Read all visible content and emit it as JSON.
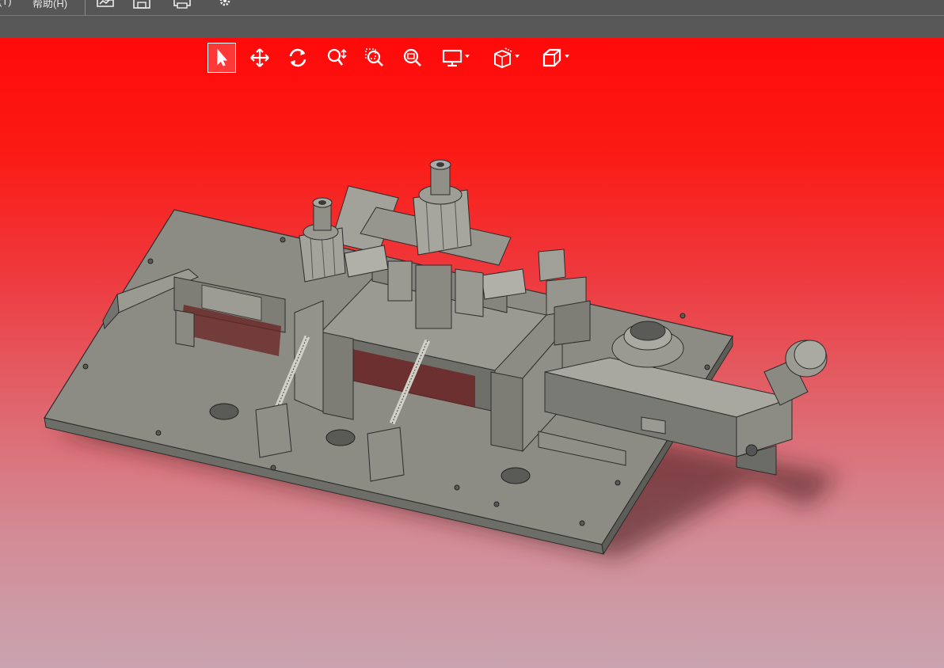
{
  "menubar": {
    "items": [
      {
        "label": "(T)"
      },
      {
        "label": "帮助(H)"
      }
    ]
  },
  "quick_access": [
    {
      "icon": "open-icon"
    },
    {
      "icon": "save-icon"
    },
    {
      "icon": "print-icon"
    },
    {
      "icon": "settings-gear-icon"
    }
  ],
  "view_toolbar": {
    "tools": [
      {
        "icon": "select-arrow-icon",
        "active": true
      },
      {
        "icon": "pan-move-icon"
      },
      {
        "icon": "rotate-icon"
      },
      {
        "icon": "zoom-in-out-icon"
      },
      {
        "icon": "zoom-to-area-icon"
      },
      {
        "icon": "zoom-to-fit-icon"
      },
      {
        "icon": "display-monitor-icon",
        "dropdown": true
      },
      {
        "icon": "section-view-icon",
        "dropdown": true
      },
      {
        "icon": "view-cube-icon",
        "dropdown": true
      }
    ]
  },
  "colors": {
    "viewport_top": "#ff0a0a",
    "viewport_bottom": "#c9a4b0",
    "model_body": "#8a8a82",
    "chrome": "#565656"
  }
}
